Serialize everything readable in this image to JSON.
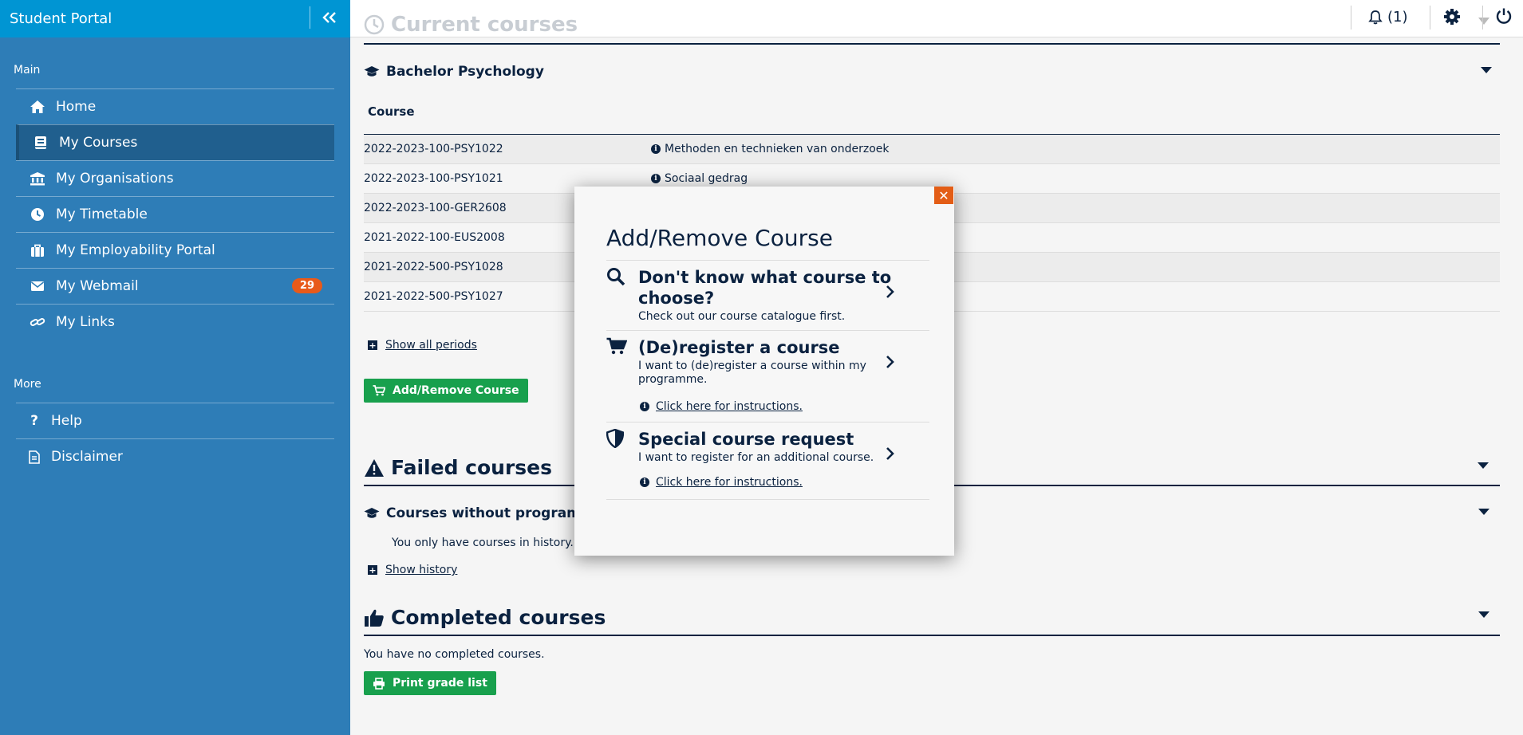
{
  "sidebar": {
    "brand": "Student Portal",
    "main_title": "Main",
    "main_items": [
      {
        "label": "Home",
        "icon": "home-icon"
      },
      {
        "label": "My Courses",
        "icon": "book-icon",
        "active": true
      },
      {
        "label": "My Organisations",
        "icon": "bank-icon"
      },
      {
        "label": "My Timetable",
        "icon": "clock-icon"
      },
      {
        "label": "My Employability Portal",
        "icon": "briefcase-icon"
      },
      {
        "label": "My Webmail",
        "icon": "envelope-icon",
        "badge": "29"
      },
      {
        "label": "My Links",
        "icon": "link-icon"
      }
    ],
    "more_title": "More",
    "more_items": [
      {
        "label": "Help",
        "icon": "question-icon"
      },
      {
        "label": "Disclaimer",
        "icon": "document-icon"
      }
    ]
  },
  "topbar": {
    "notifications": "(1)"
  },
  "current": {
    "title": "Current courses",
    "programme": "Bachelor Psychology",
    "column_header": "Course",
    "rows": [
      {
        "code": "2022-2023-100-PSY1022",
        "name": "Methoden en technieken van onderzoek"
      },
      {
        "code": "2022-2023-100-PSY1021",
        "name": "Sociaal gedrag"
      },
      {
        "code": "2022-2023-100-GER2608",
        "name": ""
      },
      {
        "code": "2021-2022-100-EUS2008",
        "name": ""
      },
      {
        "code": "2021-2022-500-PSY1028",
        "name": ""
      },
      {
        "code": "2021-2022-500-PSY1027",
        "name": ""
      }
    ],
    "show_all": "Show all periods",
    "add_remove": "Add/Remove Course"
  },
  "failed": {
    "title": "Failed courses",
    "sub": "Courses without programme",
    "note": "You only have courses in history.",
    "show_history": "Show history"
  },
  "completed": {
    "title": "Completed courses",
    "note": "You have no completed courses.",
    "print": "Print grade list"
  },
  "modal": {
    "title": "Add/Remove Course",
    "options": [
      {
        "title_line1": "Don't know what course to",
        "title_line2": "choose?",
        "sub": "Check out our course catalogue first."
      },
      {
        "title": "(De)register a course",
        "sub_line1": "I want to (de)register a course within my",
        "sub_line2": "programme.",
        "instructions": "Click here for instructions."
      },
      {
        "title": "Special course request",
        "sub": "I want to register for an additional course.",
        "instructions": "Click here for instructions."
      }
    ]
  },
  "colors": {
    "sidebar": "#2e7db7",
    "sidebar_header": "#0095d3",
    "navy": "#0b2240",
    "green": "#18a04d",
    "orange": "#e35d16"
  }
}
